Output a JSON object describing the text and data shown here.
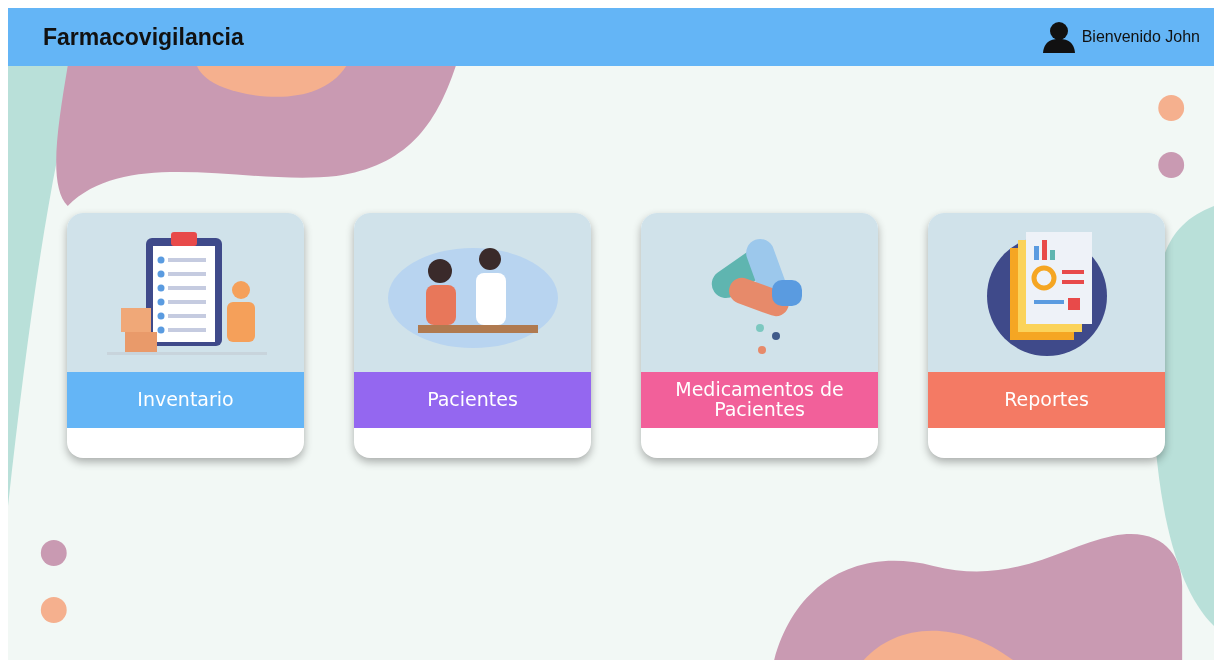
{
  "header": {
    "title": "Farmacovigilancia",
    "user_greeting": "Bienvenido John"
  },
  "cards": [
    {
      "label": "Inventario",
      "kind": "inventory",
      "color": "#64b5f6"
    },
    {
      "label": "Pacientes",
      "kind": "patients",
      "color": "#9467f0"
    },
    {
      "label": "Medicamentos de Pacientes",
      "kind": "medicines",
      "color": "#f2609a"
    },
    {
      "label": "Reportes",
      "kind": "reports",
      "color": "#f47a64"
    }
  ]
}
